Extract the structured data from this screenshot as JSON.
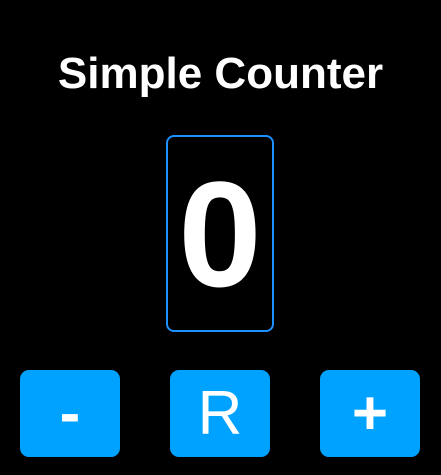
{
  "app": {
    "title": "Simple Counter"
  },
  "counter": {
    "value": "0"
  },
  "controls": {
    "decrement_label": "-",
    "reset_label": "R",
    "increment_label": "+"
  },
  "colors": {
    "background": "#000000",
    "text": "#ffffff",
    "display_border": "#1e90ff",
    "button": "#00a2ff"
  }
}
